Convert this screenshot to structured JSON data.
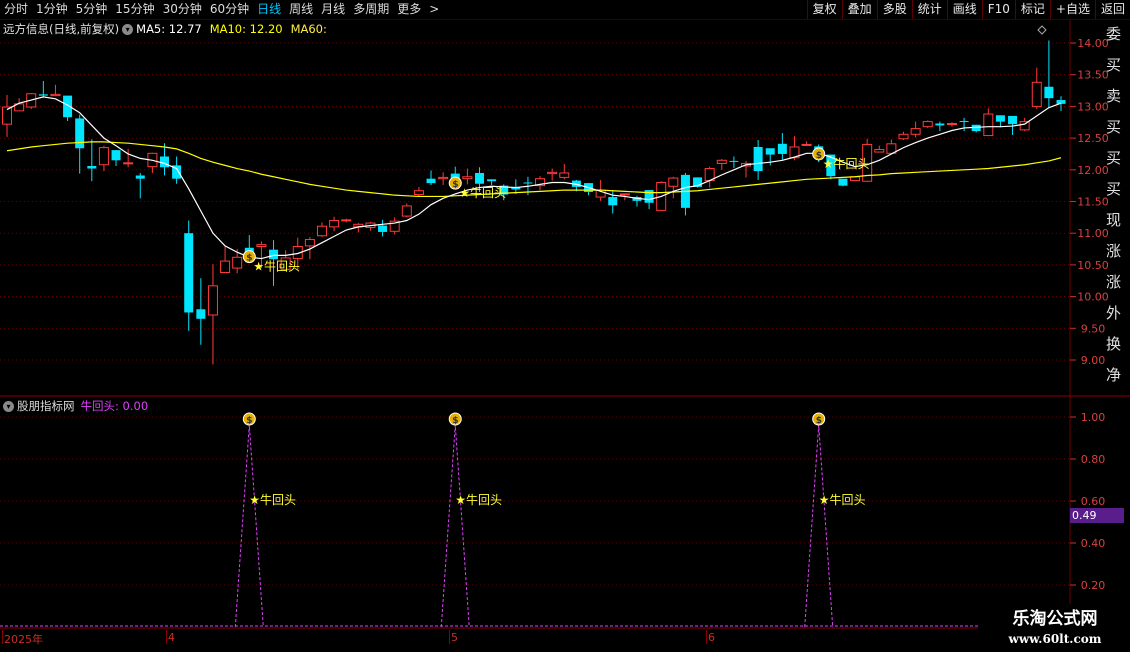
{
  "periods": [
    "分时",
    "1分钟",
    "5分钟",
    "15分钟",
    "30分钟",
    "60分钟",
    "日线",
    "周线",
    "月线",
    "多周期",
    "更多"
  ],
  "active_period": "日线",
  "more_arrow": ">",
  "tools": [
    "复权",
    "叠加",
    "多股",
    "统计",
    "画线",
    "F10",
    "标记",
    "+自选",
    "返回"
  ],
  "stock_info": {
    "name": "远方信息(日线,前复权)",
    "ma5_label": "MA5: 12.77",
    "ma10_label": "MA10: 12.20",
    "ma60_label": "MA60:"
  },
  "sub_chart": {
    "name": "股朋指标网",
    "indicator_label": "牛回头: 0.00",
    "current_value": "0.49"
  },
  "price_axis": [
    "14.00",
    "13.50",
    "13.00",
    "12.50",
    "12.00",
    "11.50",
    "11.00",
    "10.50",
    "10.00",
    "9.50",
    "9.00"
  ],
  "sub_axis": [
    "1.00",
    "0.80",
    "0.60",
    "0.40",
    "0.20"
  ],
  "signal_label": "★牛回头",
  "date_labels": [
    "2025年",
    "4",
    "5",
    "6"
  ],
  "watermark": {
    "line1": "乐淘公式网",
    "line2": "www.60lt.com"
  },
  "right_panel_chars": [
    "委",
    "买",
    "卖",
    "买",
    "买",
    "买",
    "现",
    "涨",
    "涨",
    "外",
    "换",
    "净"
  ],
  "colors": {
    "up": "#ff3a3a",
    "down": "#00e5ff",
    "ma5": "#ffffff",
    "ma10": "#ffff00",
    "ma60": "#ffee44",
    "sub_line": "#e040fb",
    "signal": "#ffff33",
    "accent": "#00c8ff",
    "grid": "#6b0000"
  },
  "chart_data": {
    "type": "candlestick",
    "ylim": [
      8.9,
      14.1
    ],
    "candles": [
      [
        12.72,
        12.99,
        12.52,
        13.18
      ],
      [
        12.93,
        13.04,
        12.93,
        13.13
      ],
      [
        12.99,
        13.2,
        12.96,
        13.21
      ],
      [
        13.19,
        13.17,
        13.15,
        13.4
      ],
      [
        13.17,
        13.19,
        13.16,
        13.34
      ],
      [
        13.17,
        12.83,
        12.77,
        13.16
      ],
      [
        12.81,
        12.34,
        11.94,
        12.87
      ],
      [
        12.06,
        12.02,
        11.82,
        12.48
      ],
      [
        12.08,
        12.35,
        11.98,
        12.38
      ],
      [
        12.31,
        12.15,
        12.06,
        12.31
      ],
      [
        12.11,
        12.11,
        12.04,
        12.33
      ],
      [
        11.91,
        11.86,
        11.55,
        11.95
      ],
      [
        12.05,
        12.26,
        11.95,
        12.27
      ],
      [
        12.21,
        12.04,
        11.91,
        12.42
      ],
      [
        12.07,
        11.86,
        11.78,
        12.21
      ],
      [
        11.0,
        9.75,
        9.46,
        11.2
      ],
      [
        9.8,
        9.65,
        9.24,
        10.29
      ],
      [
        9.71,
        10.17,
        8.93,
        10.51
      ],
      [
        10.38,
        10.56,
        10.38,
        10.79
      ],
      [
        10.45,
        10.62,
        10.37,
        10.75
      ],
      [
        10.77,
        10.63,
        10.57,
        10.97
      ],
      [
        10.79,
        10.82,
        10.45,
        10.87
      ],
      [
        10.74,
        10.59,
        10.17,
        10.89
      ],
      [
        10.43,
        10.61,
        10.43,
        10.73
      ],
      [
        10.6,
        10.79,
        10.42,
        10.93
      ],
      [
        10.8,
        10.9,
        10.59,
        10.94
      ],
      [
        10.96,
        11.11,
        10.94,
        11.17
      ],
      [
        11.1,
        11.2,
        11.03,
        11.26
      ],
      [
        11.21,
        11.21,
        11.17,
        11.23
      ],
      [
        11.1,
        11.14,
        11.01,
        11.16
      ],
      [
        11.09,
        11.16,
        11.04,
        11.18
      ],
      [
        11.12,
        11.02,
        10.95,
        11.21
      ],
      [
        11.03,
        11.19,
        10.98,
        11.25
      ],
      [
        11.27,
        11.43,
        11.25,
        11.47
      ],
      [
        11.61,
        11.67,
        11.58,
        11.73
      ],
      [
        11.86,
        11.79,
        11.76,
        11.99
      ],
      [
        11.86,
        11.88,
        11.76,
        11.96
      ],
      [
        11.94,
        11.79,
        11.77,
        12.05
      ],
      [
        11.86,
        11.89,
        11.77,
        12.02
      ],
      [
        11.95,
        11.78,
        11.65,
        12.04
      ],
      [
        11.85,
        11.82,
        11.76,
        11.85
      ],
      [
        11.75,
        11.61,
        11.52,
        11.77
      ],
      [
        11.73,
        11.69,
        11.62,
        11.85
      ],
      [
        11.8,
        11.79,
        11.6,
        11.89
      ],
      [
        11.75,
        11.86,
        11.68,
        11.9
      ],
      [
        11.94,
        11.96,
        11.83,
        12.02
      ],
      [
        11.88,
        11.95,
        11.85,
        12.09
      ],
      [
        11.83,
        11.73,
        11.66,
        11.84
      ],
      [
        11.79,
        11.65,
        11.6,
        11.79
      ],
      [
        11.57,
        11.68,
        11.51,
        11.84
      ],
      [
        11.57,
        11.44,
        11.31,
        11.66
      ],
      [
        11.61,
        11.62,
        11.52,
        11.63
      ],
      [
        11.57,
        11.51,
        11.42,
        11.59
      ],
      [
        11.68,
        11.48,
        11.38,
        11.68
      ],
      [
        11.36,
        11.8,
        11.36,
        11.82
      ],
      [
        11.74,
        11.87,
        11.55,
        11.89
      ],
      [
        11.92,
        11.4,
        11.28,
        11.95
      ],
      [
        11.88,
        11.73,
        11.72,
        11.88
      ],
      [
        11.83,
        12.02,
        11.72,
        12.05
      ],
      [
        12.1,
        12.15,
        12.0,
        12.17
      ],
      [
        12.14,
        12.13,
        12.03,
        12.21
      ],
      [
        12.06,
        12.1,
        11.88,
        12.14
      ],
      [
        12.36,
        11.98,
        11.84,
        12.47
      ],
      [
        12.34,
        12.24,
        12.07,
        12.32
      ],
      [
        12.41,
        12.25,
        12.16,
        12.58
      ],
      [
        12.19,
        12.36,
        12.15,
        12.53
      ],
      [
        12.39,
        12.4,
        12.39,
        12.45
      ],
      [
        12.37,
        12.25,
        12.12,
        12.4
      ],
      [
        12.24,
        11.9,
        11.85,
        12.24
      ],
      [
        11.86,
        11.75,
        11.74,
        11.85
      ],
      [
        11.83,
        11.89,
        11.82,
        11.9
      ],
      [
        11.82,
        12.4,
        11.81,
        12.49
      ],
      [
        12.28,
        12.32,
        12.28,
        12.38
      ],
      [
        12.26,
        12.41,
        12.24,
        12.48
      ],
      [
        12.49,
        12.56,
        12.47,
        12.6
      ],
      [
        12.56,
        12.65,
        12.51,
        12.76
      ],
      [
        12.68,
        12.76,
        12.66,
        12.78
      ],
      [
        12.73,
        12.7,
        12.61,
        12.76
      ],
      [
        12.72,
        12.73,
        12.68,
        12.75
      ],
      [
        12.77,
        12.76,
        12.61,
        12.82
      ],
      [
        12.71,
        12.61,
        12.59,
        12.71
      ],
      [
        12.54,
        12.88,
        12.54,
        12.97
      ],
      [
        12.86,
        12.76,
        12.67,
        12.81
      ],
      [
        12.85,
        12.72,
        12.55,
        12.81
      ],
      [
        12.63,
        12.76,
        12.61,
        12.82
      ],
      [
        13.0,
        13.38,
        12.96,
        13.61
      ],
      [
        13.31,
        13.13,
        12.98,
        14.04
      ],
      [
        13.1,
        13.04,
        12.93,
        13.16
      ]
    ],
    "ma5": [
      12.95,
      13.05,
      13.1,
      13.15,
      13.12,
      13.02,
      12.9,
      12.7,
      12.5,
      12.38,
      12.25,
      12.18,
      12.15,
      12.1,
      12.02,
      11.7,
      11.35,
      11.0,
      10.8,
      10.7,
      10.62,
      10.6,
      10.65,
      10.65,
      10.68,
      10.75,
      10.85,
      10.95,
      11.05,
      11.1,
      11.12,
      11.14,
      11.16,
      11.2,
      11.3,
      11.45,
      11.55,
      11.62,
      11.68,
      11.72,
      11.74,
      11.73,
      11.72,
      11.74,
      11.77,
      11.8,
      11.8,
      11.77,
      11.72,
      11.66,
      11.6,
      11.58,
      11.55,
      11.53,
      11.58,
      11.66,
      11.72,
      11.75,
      11.83,
      11.92,
      12.0,
      12.08,
      12.1,
      12.12,
      12.15,
      12.2,
      12.26,
      12.26,
      12.2,
      12.12,
      12.05,
      12.08,
      12.15,
      12.25,
      12.35,
      12.43,
      12.5,
      12.56,
      12.62,
      12.66,
      12.67,
      12.68,
      12.68,
      12.69,
      12.72,
      12.85,
      12.98,
      13.05
    ],
    "ma60": [
      12.3,
      12.33,
      12.36,
      12.38,
      12.4,
      12.42,
      12.43,
      12.44,
      12.44,
      12.43,
      12.42,
      12.4,
      12.38,
      12.36,
      12.33,
      12.26,
      12.18,
      12.12,
      12.07,
      12.02,
      11.98,
      11.93,
      11.89,
      11.85,
      11.81,
      11.77,
      11.74,
      11.71,
      11.68,
      11.66,
      11.64,
      11.62,
      11.6,
      11.59,
      11.58,
      11.58,
      11.58,
      11.59,
      11.6,
      11.61,
      11.62,
      11.63,
      11.64,
      11.65,
      11.66,
      11.67,
      11.68,
      11.68,
      11.68,
      11.68,
      11.67,
      11.66,
      11.65,
      11.64,
      11.64,
      11.65,
      11.66,
      11.67,
      11.69,
      11.71,
      11.73,
      11.75,
      11.77,
      11.79,
      11.81,
      11.83,
      11.85,
      11.86,
      11.87,
      11.88,
      11.89,
      11.91,
      11.92,
      11.94,
      11.95,
      11.96,
      11.97,
      11.98,
      11.99,
      12.0,
      12.01,
      12.02,
      12.04,
      12.06,
      12.08,
      12.11,
      12.14,
      12.19
    ],
    "signals": [
      20,
      37,
      67
    ],
    "sub_values_peak": 1.0
  }
}
